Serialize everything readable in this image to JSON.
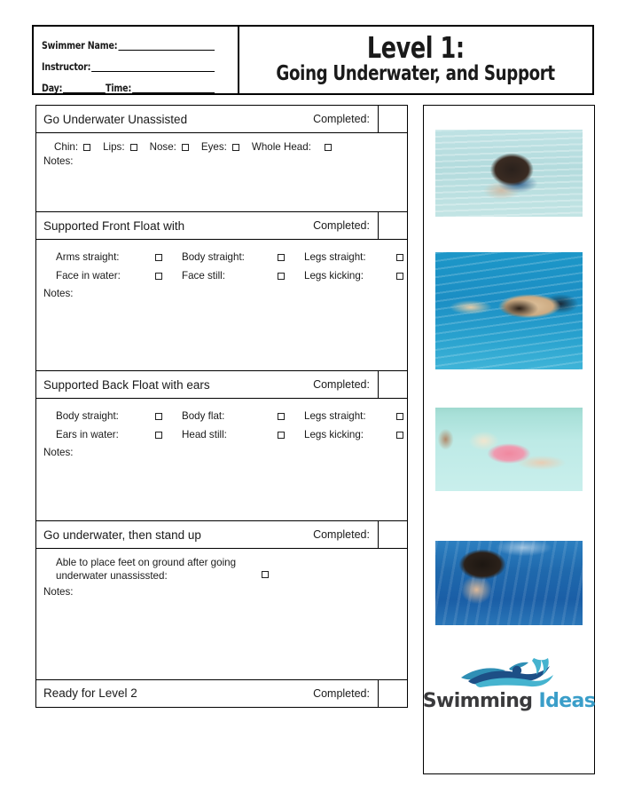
{
  "header": {
    "fields": [
      {
        "label": "Swimmer Name:",
        "value": ""
      },
      {
        "label": "Instructor:",
        "value": ""
      }
    ],
    "day_label": "Day:",
    "time_label": "Time:",
    "day_value": "",
    "time_value": "",
    "title_main": "Level 1:",
    "title_sub": "Going Underwater, and Support"
  },
  "completed_label": "Completed:",
  "notes_label": "Notes:",
  "sections": [
    {
      "title": "Go Underwater Unassisted",
      "layout": "inline",
      "items": [
        {
          "label": "Chin:",
          "checked": false
        },
        {
          "label": "Lips:",
          "checked": false
        },
        {
          "label": "Nose:",
          "checked": false
        },
        {
          "label": "Eyes:",
          "checked": false
        },
        {
          "label": "Whole Head:",
          "checked": false
        }
      ]
    },
    {
      "title": "Supported Front Float with",
      "layout": "grid",
      "rows": [
        [
          {
            "label": "Arms straight:",
            "checked": false
          },
          {
            "label": "Body straight:",
            "checked": false
          },
          {
            "label": "Legs straight:",
            "checked": false
          }
        ],
        [
          {
            "label": "Face in water:",
            "checked": false
          },
          {
            "label": "Face still:",
            "checked": false
          },
          {
            "label": "Legs kicking:",
            "checked": false
          }
        ]
      ]
    },
    {
      "title": "Supported Back Float with ears",
      "layout": "grid",
      "rows": [
        [
          {
            "label": "Body straight:",
            "checked": false
          },
          {
            "label": "Body flat:",
            "checked": false
          },
          {
            "label": "Legs straight:",
            "checked": false
          }
        ],
        [
          {
            "label": "Ears in water:",
            "checked": false
          },
          {
            "label": "Head still:",
            "checked": false
          },
          {
            "label": "Legs kicking:",
            "checked": false
          }
        ]
      ]
    },
    {
      "title": "Go underwater, then stand up",
      "layout": "twoline",
      "item": {
        "label": "Able to place feet on ground after going underwater unassissted:",
        "checked": false
      }
    },
    {
      "title": "Ready for Level 2",
      "layout": "header-only"
    }
  ],
  "photos": [
    {
      "caption": "child-going-underwater-photo"
    },
    {
      "caption": "swimmer-front-float-photo"
    },
    {
      "caption": "child-back-float-photo"
    },
    {
      "caption": "child-underwater-photo"
    }
  ],
  "logo": {
    "word1": "Swimming",
    "word2": "Ideas",
    "color_dark": "#3a3a3c",
    "color_blue": "#3a9ec9"
  }
}
